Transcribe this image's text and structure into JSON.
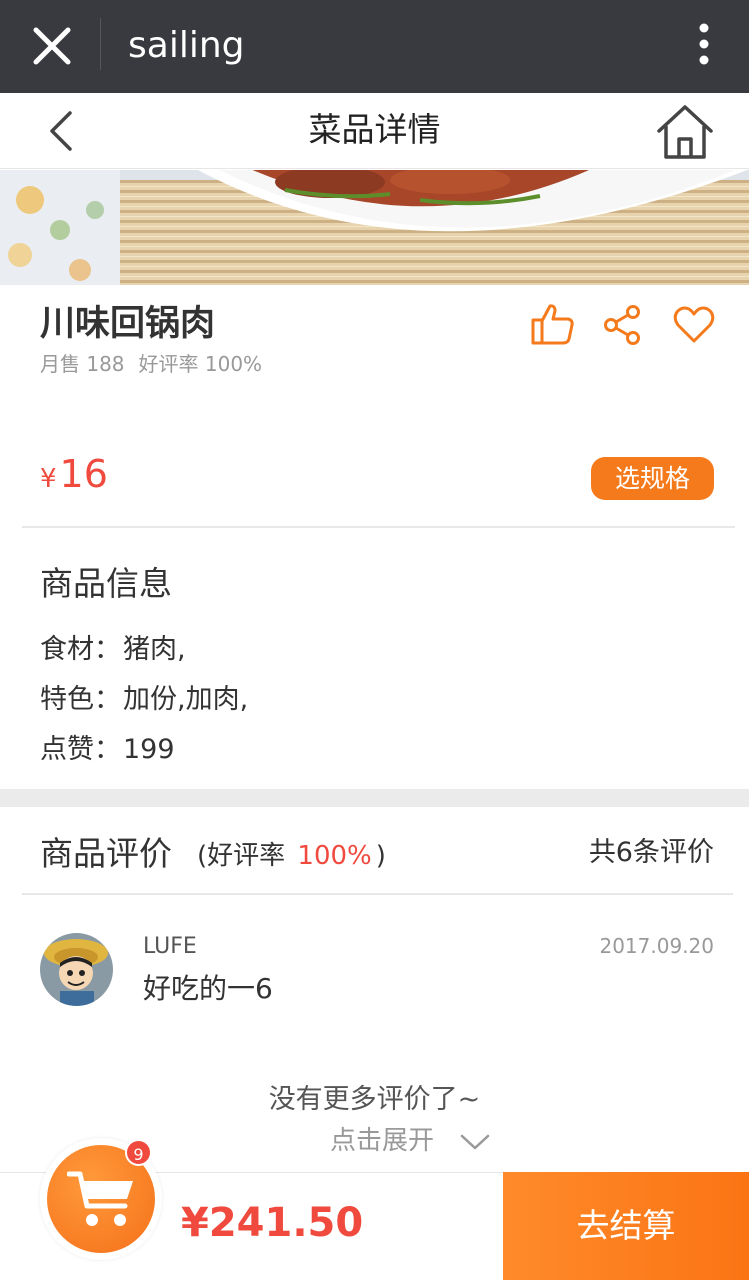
{
  "window": {
    "title": "sailing"
  },
  "navbar": {
    "title": "菜品详情"
  },
  "dish": {
    "name": "川味回锅肉",
    "monthly_sales": "月售 188",
    "rating": "好评率 100%",
    "currency": "¥",
    "price": "16",
    "spec_label": "选规格"
  },
  "info": {
    "title": "商品信息",
    "rows": [
      {
        "label": "食材：",
        "value": "猪肉,"
      },
      {
        "label": "特色：",
        "value": "加份,加肉,"
      },
      {
        "label": "点赞：",
        "value": "199"
      }
    ]
  },
  "reviews": {
    "title": "商品评价",
    "rate_prefix": "(好评率",
    "rate_value": "100%",
    "rate_suffix": ")",
    "count": "共6条评价",
    "items": [
      {
        "user": "LUFE",
        "date": "2017.09.20",
        "text": "好吃的一6"
      }
    ],
    "no_more": "没有更多评价了~",
    "expand_label": "点击展开"
  },
  "cart": {
    "badge": "9",
    "total": "¥241.50",
    "checkout_label": "去结算"
  },
  "colors": {
    "accent": "#f57a1c",
    "price": "#f04a3e",
    "topbar": "#393a3f"
  },
  "icons": [
    "close-icon",
    "more-icon",
    "back-icon",
    "home-icon",
    "thumbs-up-icon",
    "share-icon",
    "heart-icon",
    "chevron-down-icon",
    "cart-icon"
  ]
}
